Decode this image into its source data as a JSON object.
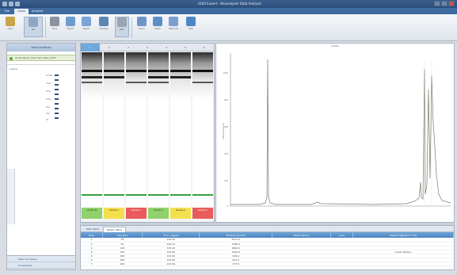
{
  "window": {
    "title": "2100 Expert - Bioanalyzer Data Analysis",
    "controls": [
      "minimize-button",
      "maximize-button",
      "close-button"
    ]
  },
  "menu_tabs": [
    {
      "label": "File",
      "active": false
    },
    {
      "label": "Home",
      "active": true
    },
    {
      "label": "Analysis",
      "active": false
    }
  ],
  "ribbon": {
    "buttons": [
      {
        "label": "Open",
        "icon": "folder-icon",
        "color": "#c9a54a"
      },
      {
        "label": "Gel",
        "icon": "gel-view-icon",
        "color": "#8ea6c4",
        "selected": true
      },
      {
        "label": "Print",
        "icon": "print-icon",
        "color": "#8b93a0"
      },
      {
        "label": "Export",
        "icon": "export-icon",
        "color": "#6c9bd0"
      },
      {
        "label": "Report",
        "icon": "report-icon",
        "color": "#7aa5d8"
      },
      {
        "label": "Compare",
        "icon": "compare-icon",
        "color": "#5d86b8"
      },
      {
        "label": "Filter",
        "icon": "filter-icon",
        "color": "#9aa4b2"
      },
      {
        "label": "Zoom",
        "icon": "zoom-icon",
        "color": "#6f95c7"
      },
      {
        "label": "Peaks",
        "icon": "peaks-icon",
        "color": "#5e8ec8"
      },
      {
        "label": "Setpoints",
        "icon": "setpoints-icon",
        "color": "#7a9fcc"
      },
      {
        "label": "Help",
        "icon": "help-icon",
        "color": "#4f86c6"
      }
    ]
  },
  "left_panel": {
    "header": "Data Contents",
    "file_entry": "2100 expert_High Sens DNA_2013",
    "ladder_label": "Ladder",
    "ladder_ticks": [
      "10380",
      "7000",
      "3000",
      "1000",
      "500",
      "300",
      "35"
    ],
    "footer_items": [
      "Data and Assay",
      "Comparison"
    ]
  },
  "gel": {
    "lane_headers": [
      "L",
      "1",
      "2",
      "3",
      "4",
      "5",
      "6"
    ],
    "selected_lane_header": "L",
    "lane_labels": [
      {
        "text": "Ladder OK",
        "status": "green"
      },
      {
        "text": "Sample 1",
        "status": "yellow"
      },
      {
        "text": "Sample 2",
        "status": "red"
      },
      {
        "text": "Sample 3",
        "status": "green"
      },
      {
        "text": "Sample 4",
        "status": "yellow"
      },
      {
        "text": "Sample 5",
        "status": "red"
      }
    ],
    "status_colors": {
      "green": "#8fd16a",
      "yellow": "#f4e04d",
      "red": "#ea5b5b"
    },
    "marker_color": "#3aa040"
  },
  "electropherogram": {
    "title": "Ladder",
    "y_axis_label": "Fluorescence",
    "y_tick_labels": [
      "1000",
      "800",
      "600",
      "400",
      "200",
      "0"
    ],
    "line_color": "#7a7a6a"
  },
  "bottom_panel": {
    "tabs": [
      {
        "label": "Peak Table",
        "active": false
      },
      {
        "label": "Region Table",
        "active": true
      }
    ],
    "columns": [
      "Peak",
      "Size [bp]",
      "Conc. [pg/µl]",
      "Molarity [pmol/l]",
      "Observations",
      "Area",
      "Aligned Migration Time"
    ],
    "rows": [
      [
        "1",
        "35",
        "125.00",
        "5411.3",
        "",
        "",
        ""
      ],
      [
        "2",
        "50",
        "125.00",
        "3788.0",
        "",
        "",
        ""
      ],
      [
        "3",
        "100",
        "125.00",
        "1894.0",
        "",
        "",
        ""
      ],
      [
        "4",
        "150",
        "125.00",
        "1262.6",
        "",
        "",
        "Lower Marker"
      ],
      [
        "5",
        "200",
        "125.00",
        "946.9",
        "",
        "",
        ""
      ],
      [
        "6",
        "300",
        "125.00",
        "631.3",
        "",
        "",
        ""
      ],
      [
        "7",
        "400",
        "125.00",
        "473.5",
        "",
        "",
        ""
      ]
    ]
  }
}
